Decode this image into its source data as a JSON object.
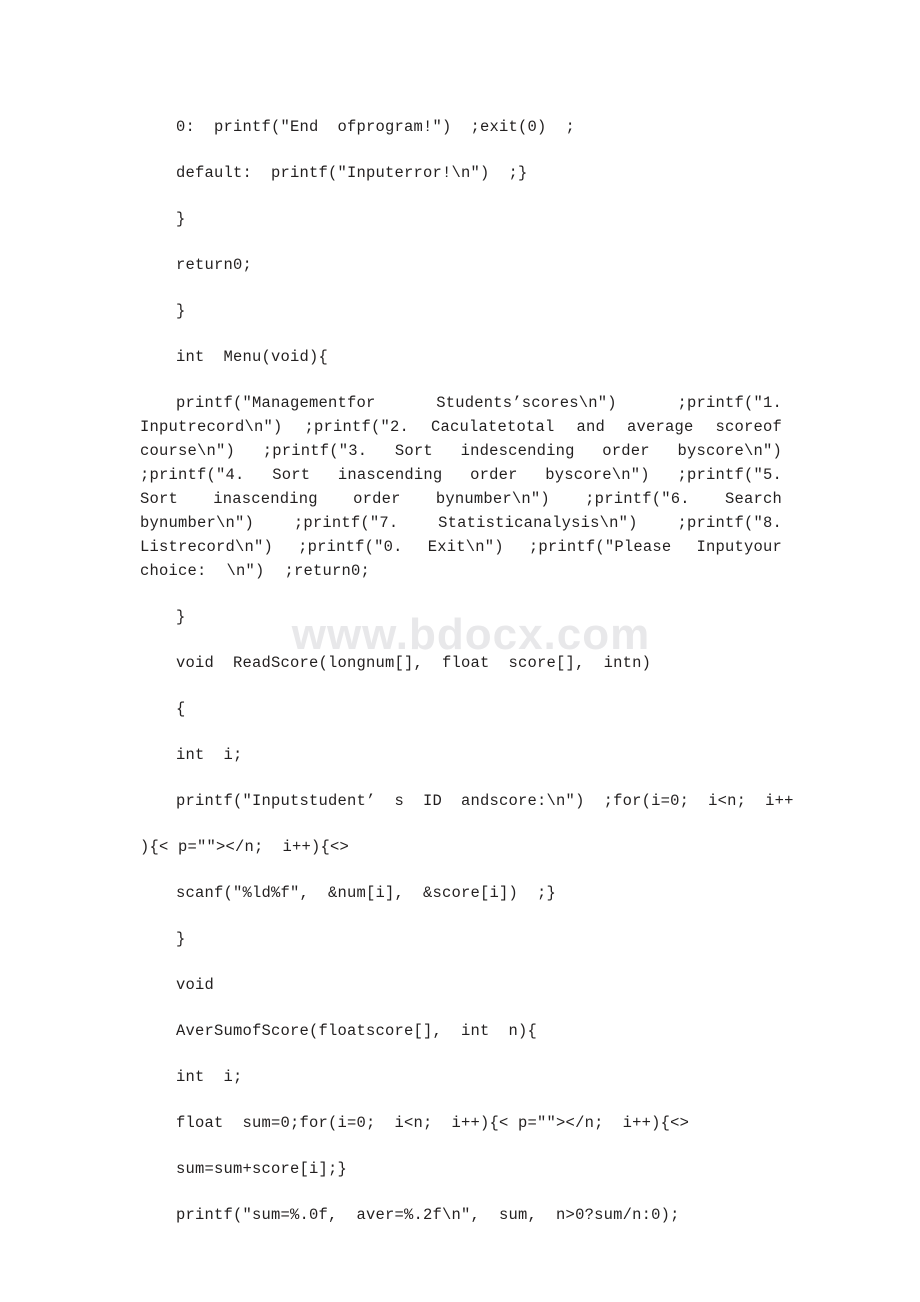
{
  "document": {
    "watermark": "www.bdocx.com",
    "background_color": "#ffffff",
    "text_color": "#221f1f",
    "watermark_color": "#e8e8ea"
  },
  "code": {
    "lines": [
      {
        "id": "l1",
        "indent": true,
        "text": "0:  printf(″End  ofprogram!″)  ;exit(0)  ;"
      },
      {
        "id": "l2",
        "indent": true,
        "text": "default:  printf(″Inputerror!\\n″)  ;}"
      },
      {
        "id": "l3",
        "indent": true,
        "text": "}"
      },
      {
        "id": "l4",
        "indent": true,
        "text": "return0;"
      },
      {
        "id": "l5",
        "indent": true,
        "text": "}"
      },
      {
        "id": "l6",
        "indent": true,
        "text": "int  Menu(void){"
      }
    ],
    "menu_paragraph": "printf(″Managementfor  Students’scores\\n″)  ;printf(″1.  Inputrecord\\n″)  ;printf(″2.  Caculatetotal  and  average  scoreof  course\\n″)  ;printf(″3.  Sort  indescending  order  byscore\\n″)  ;printf(″4.  Sort  inascending  order  byscore\\n″)  ;printf(″5.  Sort  inascending  order  bynumber\\n″)  ;printf(″6.  Search  bynumber\\n″)  ;printf(″7.  Statisticanalysis\\n″)  ;printf(″8.  Listrecord\\n″)  ;printf(″0.  Exit\\n″)  ;printf(″Please  Inputyour  choice:  \\n″)  ;return0;",
    "lines_after": [
      {
        "id": "l7",
        "indent": true,
        "text": "}"
      },
      {
        "id": "l8",
        "indent": true,
        "text": "void  ReadScore(longnum[],  float  score[],  intn)"
      },
      {
        "id": "l9",
        "indent": true,
        "text": "{"
      },
      {
        "id": "l10",
        "indent": true,
        "text": "int  i;"
      },
      {
        "id": "l11",
        "indent": true,
        "text": "printf(″Inputstudent’  s  ID  andscore:\\n″)  ;for(i=0;  i<n;  i++"
      },
      {
        "id": "l12",
        "indent": false,
        "text": "){< p=″″></n;  i++){<>"
      },
      {
        "id": "l13",
        "indent": true,
        "text": "scanf(″%ld%f″,  &num[i],  &score[i])  ;}"
      },
      {
        "id": "l14",
        "indent": true,
        "text": "}"
      },
      {
        "id": "l15",
        "indent": true,
        "text": "void"
      },
      {
        "id": "l16",
        "indent": true,
        "text": "AverSumofScore(floatscore[],  int  n){"
      },
      {
        "id": "l17",
        "indent": true,
        "text": "int  i;"
      },
      {
        "id": "l18",
        "indent": true,
        "text": "float  sum=0;for(i=0;  i<n;  i++){< p=″″></n;  i++){<>"
      },
      {
        "id": "l19",
        "indent": true,
        "text": "sum=sum+score[i];}"
      },
      {
        "id": "l20",
        "indent": true,
        "text": "printf(″sum=%.0f,  aver=%.2f\\n″,  sum,  n>0?sum/n:0);"
      }
    ]
  }
}
